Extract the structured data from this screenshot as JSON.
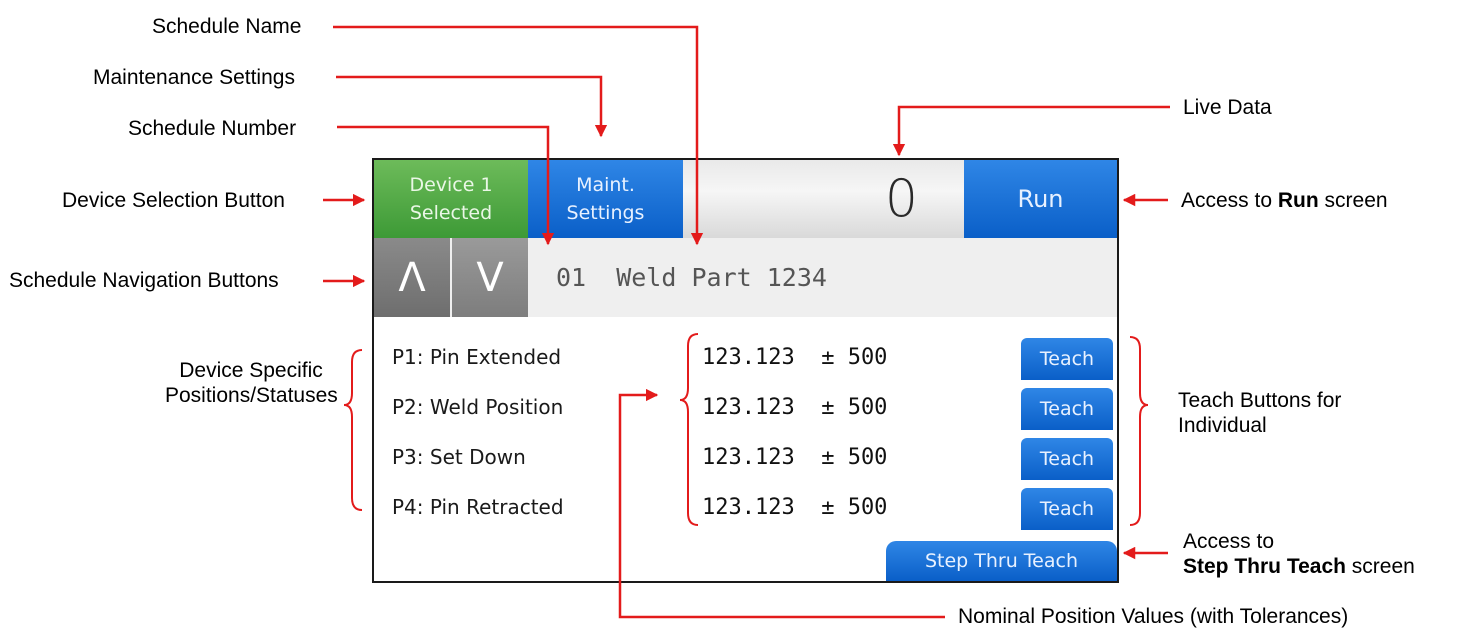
{
  "callouts": {
    "schedule_name": "Schedule Name",
    "maintenance_settings": "Maintenance Settings",
    "schedule_number": "Schedule Number",
    "live_data": "Live Data",
    "device_selection_button": "Device Selection Button",
    "access_run_pre": "Access to ",
    "access_run_bold": "Run",
    "access_run_post": " screen",
    "schedule_navigation_buttons": "Schedule Navigation Buttons",
    "device_specific_line1": "Device Specific",
    "device_specific_line2": "Positions/Statuses",
    "teach_buttons_line1": "Teach Buttons for",
    "teach_buttons_line2": "Individual",
    "access_step_line1": "Access to",
    "access_step_bold": "Step Thru Teach",
    "access_step_post": " screen",
    "nominal_values": "Nominal Position Values (with Tolerances)"
  },
  "screen": {
    "device_button": {
      "line1": "Device 1",
      "line2": "Selected"
    },
    "maint_button": {
      "line1": "Maint.",
      "line2": "Settings"
    },
    "live_value": "0",
    "run_button": "Run",
    "nav_up": "Λ",
    "nav_down": "V",
    "schedule": "01  Weld Part 1234",
    "positions": [
      {
        "label": "P1: Pin Extended",
        "value": "123.123  ± 500",
        "teach": "Teach"
      },
      {
        "label": "P2: Weld Position",
        "value": "123.123  ± 500",
        "teach": "Teach"
      },
      {
        "label": "P3: Set Down",
        "value": "123.123  ± 500",
        "teach": "Teach"
      },
      {
        "label": "P4: Pin Retracted",
        "value": "123.123  ± 500",
        "teach": "Teach"
      }
    ],
    "step_button": "Step Thru Teach"
  },
  "colors": {
    "arrow": "#e31b1b",
    "device_green": "#4caa3f",
    "button_blue": "#1670d9",
    "nav_gray": "#7c7c7c"
  }
}
